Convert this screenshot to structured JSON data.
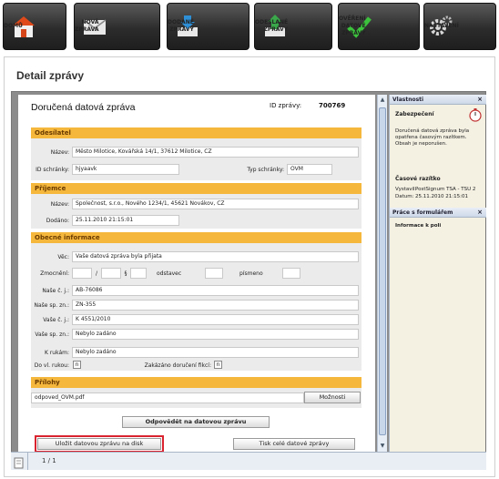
{
  "nav": {
    "home": "DOMŮ",
    "new_message": "NOVÁ\nZPRÁVA",
    "received": "DODANÉ\nZPRÁVY",
    "sent": "ODESLANÉ\nZPRÁVY",
    "verify": "OVĚŘENÍ\nDATOVÉ\nZPRÁVY",
    "settings": "NASTAVENÍ"
  },
  "page": {
    "title": "Detail zprávy"
  },
  "document": {
    "title": "Doručená datová zpráva",
    "id_label": "ID zprávy:",
    "id_value": "700769",
    "sender": {
      "header": "Odesílatel",
      "name_label": "Název:",
      "name_value": "Město Milotice, Kovářská 14/1, 37612 Milotice, CZ",
      "box_label": "ID schránky:",
      "box_value": "hjyaavk",
      "type_label": "Typ schránky:",
      "type_value": "OVM"
    },
    "recipient": {
      "header": "Příjemce",
      "name_label": "Název:",
      "name_value": "Společnost, s.r.o., Nového 1234/1, 45621 Novákov, CZ",
      "delivered_label": "Dodáno:",
      "delivered_value": "25.11.2010 21:15:01"
    },
    "general": {
      "header": "Obecné informace",
      "subject_label": "Věc:",
      "subject_value": "Vaše datová zpráva byla přijata",
      "authorization_label": "Zmocnění:",
      "slash": "/",
      "paragraph": "§",
      "odstavec_label": "odstavec",
      "pismeno_label": "písmeno",
      "our_ref_label": "Naše č. j.:",
      "our_ref_value": "AB-76086",
      "our_file_label": "Naše sp. zn.:",
      "our_file_value": "ZN-355",
      "your_ref_label": "Vaše č. j.:",
      "your_ref_value": "K 4551/2010",
      "your_file_label": "Vaše sp. zn.:",
      "your_file_value": "Nebylo zadáno",
      "attention_label": "K rukám:",
      "attention_value": "Nebylo zadáno",
      "personal_label": "Do vl. rukou:",
      "personal_value": "n",
      "fiction_label": "Zakázáno doručení fikcí:",
      "fiction_value": "n"
    },
    "attachments": {
      "header": "Přílohy",
      "file": "odpoved_OVM.pdf",
      "options_button": "Možnosti"
    },
    "reply_button": "Odpovědět na datovou zprávu",
    "save_button": "Uložit datovou zprávu na disk",
    "print_button": "Tisk celé datové zprávy"
  },
  "sidebar": {
    "properties_title": "Vlastnosti",
    "close": "×",
    "security_title": "Zabezpečení",
    "security_text": "Doručená datová zpráva byla opatřena časovým razítkem. Obsah je neporušen.",
    "timestamp_title": "Časové razítko",
    "issued_label": "Vystavil:",
    "issued_value": "PostSignum TSA - TSU 2",
    "date_label": "Datum:",
    "date_value": "25.11.2010 21:15:01",
    "forms_title": "Práce s formulářem",
    "field_info": "Informace k poli"
  },
  "status": {
    "page": "1 / 1"
  },
  "colors": {
    "section": "#f5b83d",
    "nav": "#2c2c2c",
    "highlight": "#d9232e"
  }
}
